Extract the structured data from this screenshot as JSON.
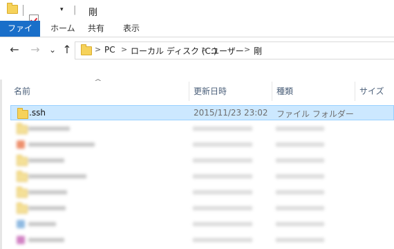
{
  "window": {
    "title": "剛",
    "quick_access_dropdown": "▾",
    "separator": "|"
  },
  "ribbon": {
    "tabs": [
      {
        "label": "ファイル",
        "active": true
      },
      {
        "label": "ホーム"
      },
      {
        "label": "共有"
      },
      {
        "label": "表示"
      }
    ]
  },
  "nav": {
    "back": "←",
    "forward": "→",
    "recent": "⌄",
    "up": "↑"
  },
  "address": {
    "crumbs": [
      "PC",
      "ローカル ディスク (C:)",
      "ユーザー",
      "剛"
    ],
    "separator": ">"
  },
  "columns": {
    "name": "名前",
    "date": "更新日時",
    "type": "種類",
    "size": "サイズ",
    "sort_indicator": "^"
  },
  "files": [
    {
      "name": ".ssh",
      "date": "2015/11/23 23:02",
      "type": "ファイル フォルダー",
      "selected": true
    }
  ],
  "colors": {
    "accent": "#1a6fc9",
    "selection_fill": "#cce8ff",
    "selection_border": "#99d1ff",
    "folder": "#f6d25a"
  }
}
